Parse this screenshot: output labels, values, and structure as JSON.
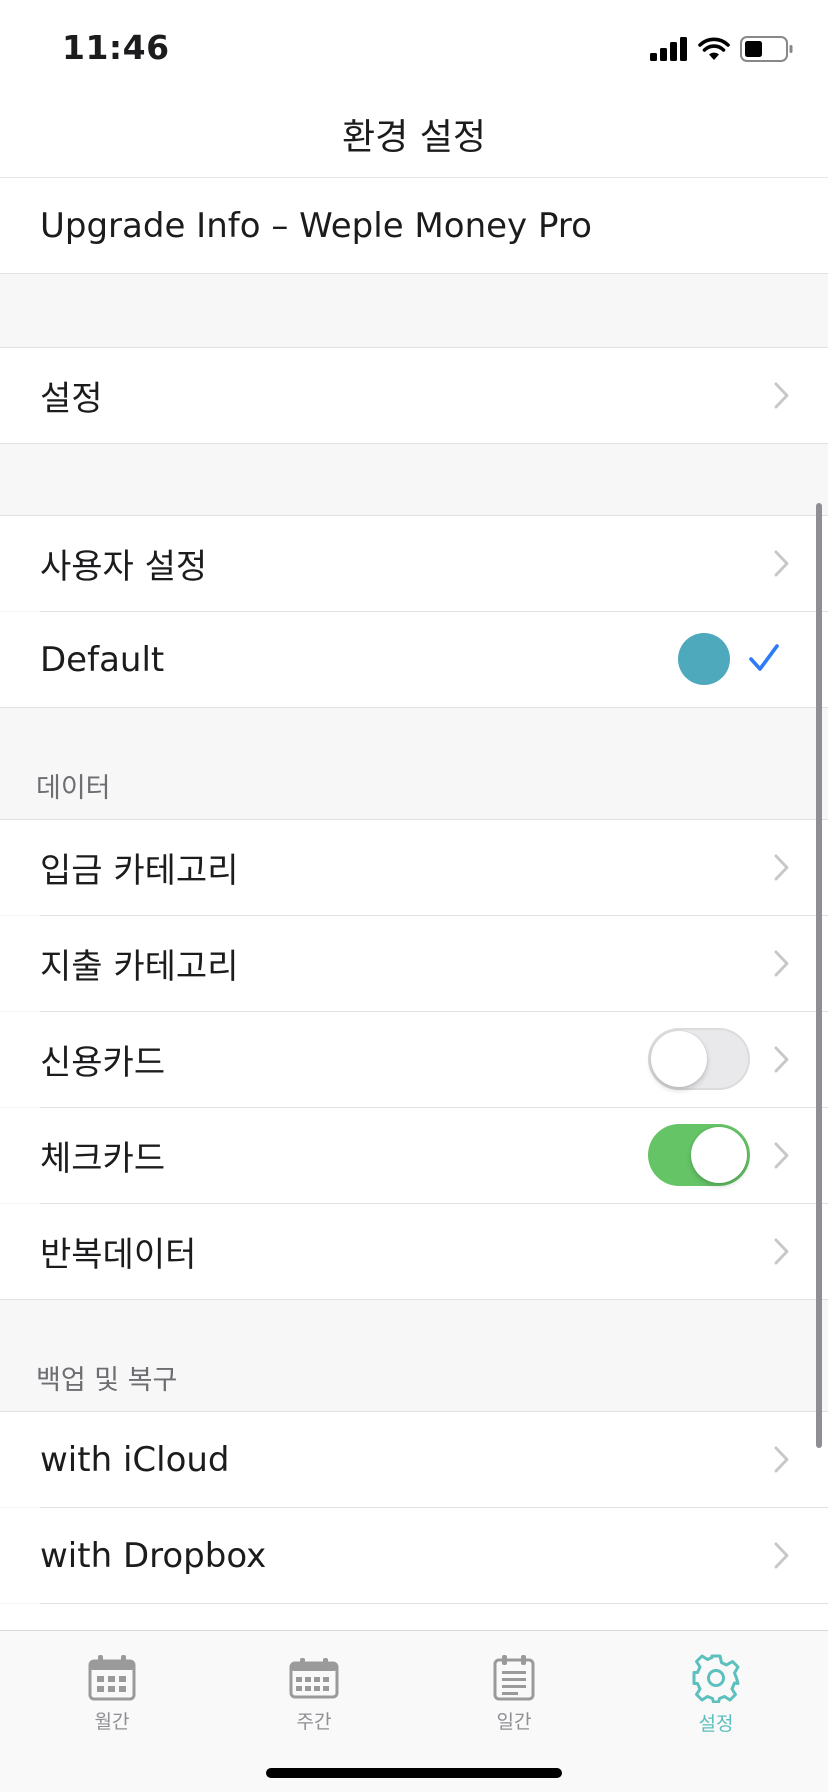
{
  "status_bar": {
    "time": "11:46"
  },
  "nav": {
    "title": "환경 설정"
  },
  "rows": {
    "upgrade": "Upgrade Info – Weple Money Pro",
    "settings": "설정",
    "user_settings": "사용자 설정",
    "default_theme": "Default"
  },
  "theme": {
    "selected_color": "#4ea9bd",
    "check_color": "#2f7bf5"
  },
  "data_section": {
    "header": "데이터",
    "income_category": "입금 카테고리",
    "expense_category": "지출 카테고리",
    "credit_card": "신용카드",
    "credit_card_enabled": false,
    "check_card": "체크카드",
    "check_card_enabled": true,
    "recurring_data": "반복데이터"
  },
  "backup_section": {
    "header": "백업 및 복구",
    "icloud": "with iCloud",
    "dropbox": "with Dropbox"
  },
  "tabs": [
    {
      "label": "월간",
      "icon": "calendar-month-icon",
      "active": false
    },
    {
      "label": "주간",
      "icon": "calendar-week-icon",
      "active": false
    },
    {
      "label": "일간",
      "icon": "calendar-day-icon",
      "active": false
    },
    {
      "label": "설정",
      "icon": "gear-icon",
      "active": true
    }
  ],
  "colors": {
    "accent": "#5bc0be",
    "toggle_on": "#65c466"
  }
}
